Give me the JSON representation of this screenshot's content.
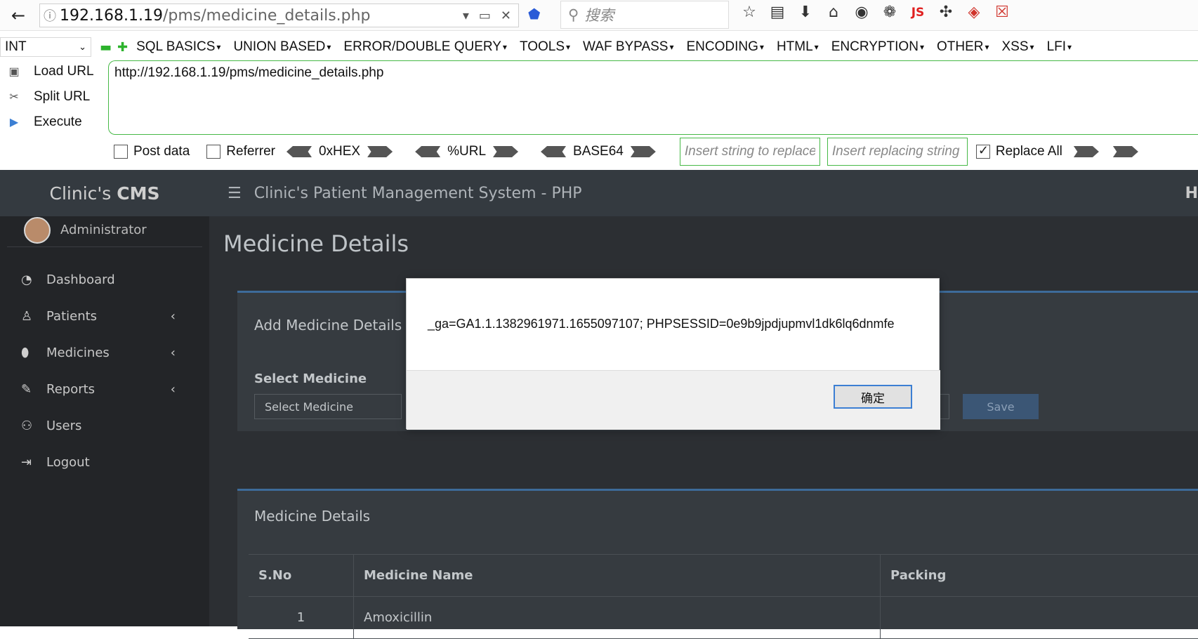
{
  "browser": {
    "url_host": "192.168.1.19",
    "url_path": "/pms/medicine_details.php",
    "search_placeholder": "搜索"
  },
  "hackbar": {
    "select_value": "INT",
    "menu": [
      "SQL BASICS",
      "UNION BASED",
      "ERROR/DOUBLE QUERY",
      "TOOLS",
      "WAF BYPASS",
      "ENCODING",
      "HTML",
      "ENCRYPTION",
      "OTHER",
      "XSS",
      "LFI"
    ],
    "load_url": "Load URL",
    "split_url": "Split URL",
    "execute": "Execute",
    "url_value": "http://192.168.1.19/pms/medicine_details.php",
    "post_data": "Post data",
    "referrer": "Referrer",
    "hex": "0xHEX",
    "url_enc": "%URL",
    "base64": "BASE64",
    "replace_from_placeholder": "Insert string to replace",
    "replace_to_placeholder": "Insert replacing string",
    "replace_all": "Replace All"
  },
  "cms": {
    "brand_prefix": "Clinic's",
    "brand_suffix": "CMS",
    "user_name": "Administrator",
    "topbar_title": "Clinic's Patient Management System - PHP",
    "topbar_right": "H",
    "nav": [
      {
        "label": "Dashboard",
        "icon": "gauge-icon"
      },
      {
        "label": "Patients",
        "icon": "patient-icon",
        "has_chevron": true
      },
      {
        "label": "Medicines",
        "icon": "pills-icon",
        "has_chevron": true
      },
      {
        "label": "Reports",
        "icon": "edit-icon",
        "has_chevron": true
      },
      {
        "label": "Users",
        "icon": "users-icon"
      },
      {
        "label": "Logout",
        "icon": "logout-icon"
      }
    ],
    "page_title": "Medicine Details",
    "add_card_title": "Add Medicine Details",
    "select_label": "Select Medicine",
    "select_value": "Select Medicine",
    "save_label": "Save",
    "list_card_title": "Medicine Details",
    "table_headers": [
      "S.No",
      "Medicine Name",
      "Packing"
    ],
    "table_rows": [
      {
        "sno": "1",
        "name": "Amoxicillin",
        "packing": ""
      }
    ]
  },
  "dialog": {
    "message": "_ga=GA1.1.1382961971.1655097107; PHPSESSID=0e9b9jpdjupmvl1dk6lq6dnmfe",
    "ok_label": "确定"
  }
}
